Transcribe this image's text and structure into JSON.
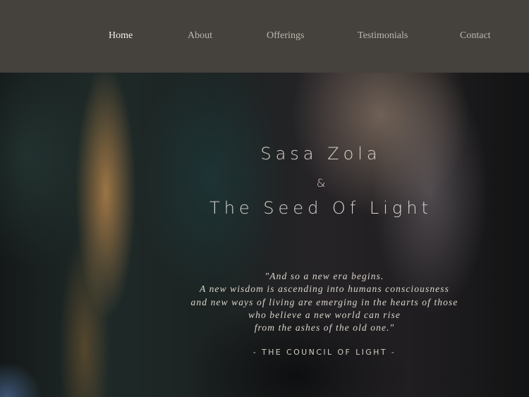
{
  "nav": {
    "items": [
      {
        "label": "Home"
      },
      {
        "label": "About"
      },
      {
        "label": "Offerings"
      },
      {
        "label": "Testimonials"
      },
      {
        "label": "Contact"
      }
    ],
    "active": "Home"
  },
  "hero": {
    "title_line1": "Sasa Zola",
    "ampersand": "&",
    "title_line2": "The Seed Of Light",
    "quote_lines": [
      "\"And so a new era begins.",
      "A new wisdom is ascending into humans consciousness",
      "and new ways of living are emerging in the hearts of those",
      "who believe a new world can rise",
      "from the ashes of the old one.\""
    ],
    "attribution": "- THE COUNCIL OF LIGHT -"
  },
  "colors": {
    "nav_background": "#45413d",
    "active_link": "#f3f0ea",
    "inactive_link": "#bcb7ae"
  }
}
